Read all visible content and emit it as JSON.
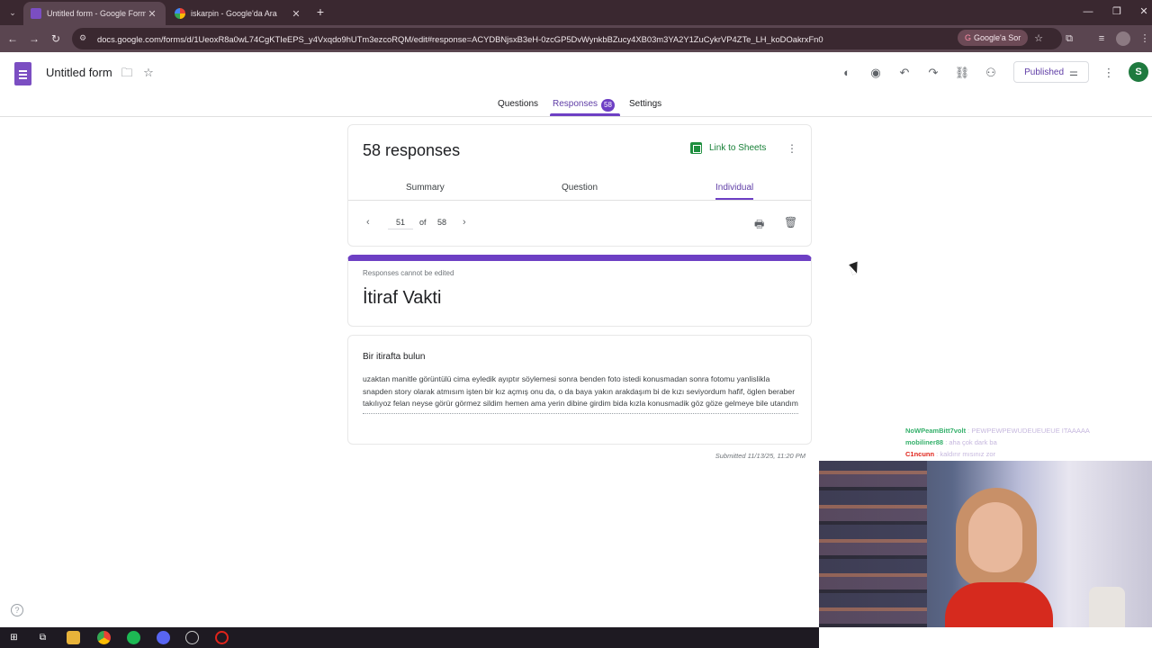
{
  "browser": {
    "tabs": [
      {
        "title": "Untitled form - Google Forms",
        "active": true
      },
      {
        "title": "iskarpin - Google'da Ara",
        "active": false
      }
    ],
    "url": "docs.google.com/forms/d/1UeoxR8a0wL74CgKTIeEPS_y4Vxqdo9hUTm3ezcoRQM/edit#response=ACYDBNjsxB3eH-0zcGP5DvWynkbBZucy4XB03m3YA2Y1ZuCykrVP4ZTe_LH_koDOakrxFn0",
    "search_pill": "Google'a Sor"
  },
  "form": {
    "title": "Untitled form",
    "publish_label": "Published",
    "avatar_initial": "S"
  },
  "main_tabs": {
    "questions": "Questions",
    "responses": "Responses",
    "responses_count": "58",
    "settings": "Settings"
  },
  "responses": {
    "count_label": "58 responses",
    "link_sheets": "Link to Sheets",
    "subtabs": {
      "summary": "Summary",
      "question": "Question",
      "individual": "Individual"
    },
    "pager": {
      "current": "51",
      "of": "of",
      "total": "58"
    }
  },
  "response_view": {
    "cannot_edit": "Responses cannot be edited",
    "form_heading": "İtiraf Vakti",
    "question": "Bir itirafta bulun",
    "answer": "uzaktan manitle görüntülü cima eyledik ayıptır söylemesi sonra benden foto istedi konusmadan sonra fotomu yanlislikla snapden story olarak atmısım işten bir kız açmış onu da, o da baya yakın arakdaşım bi de kızı seviyordum hafif, öglen beraber takılıyoz felan  neyse görür görmez sildim hemen ama yerin dibine girdim bida kızla konusmadik göz göze gelmeye bile utandım",
    "submitted": "Submitted 11/13/25, 11:20 PM"
  },
  "chat": [
    {
      "user": "NoWPeamBitt7volt",
      "text": "PEWPEWPEWUDEUEUEUE ITAAAAA",
      "color": "#35b06b"
    },
    {
      "user": "mobiliner88",
      "text": "aha çok dark ba",
      "color": "#35b06b"
    },
    {
      "user": "C1ncunn",
      "text": "kaldırır mısınız zor",
      "color": "#e0241b"
    }
  ],
  "icons": {
    "tab_dropdown": "chevron-down-icon",
    "back": "arrow-left-icon",
    "forward": "arrow-right-icon",
    "reload": "reload-icon",
    "folder": "folder-icon",
    "star": "star-icon",
    "palette": "palette-icon",
    "preview": "eye-icon",
    "undo": "undo-icon",
    "redo": "redo-icon",
    "link": "link-icon",
    "add_collaborator": "person-add-icon",
    "more": "more-vert-icon",
    "print": "print-icon",
    "delete": "trash-icon",
    "help": "help-icon"
  },
  "colors": {
    "accent": "#6d3fc4",
    "sheets_green": "#1e8e3e",
    "browser_frame": "#3a2830"
  }
}
